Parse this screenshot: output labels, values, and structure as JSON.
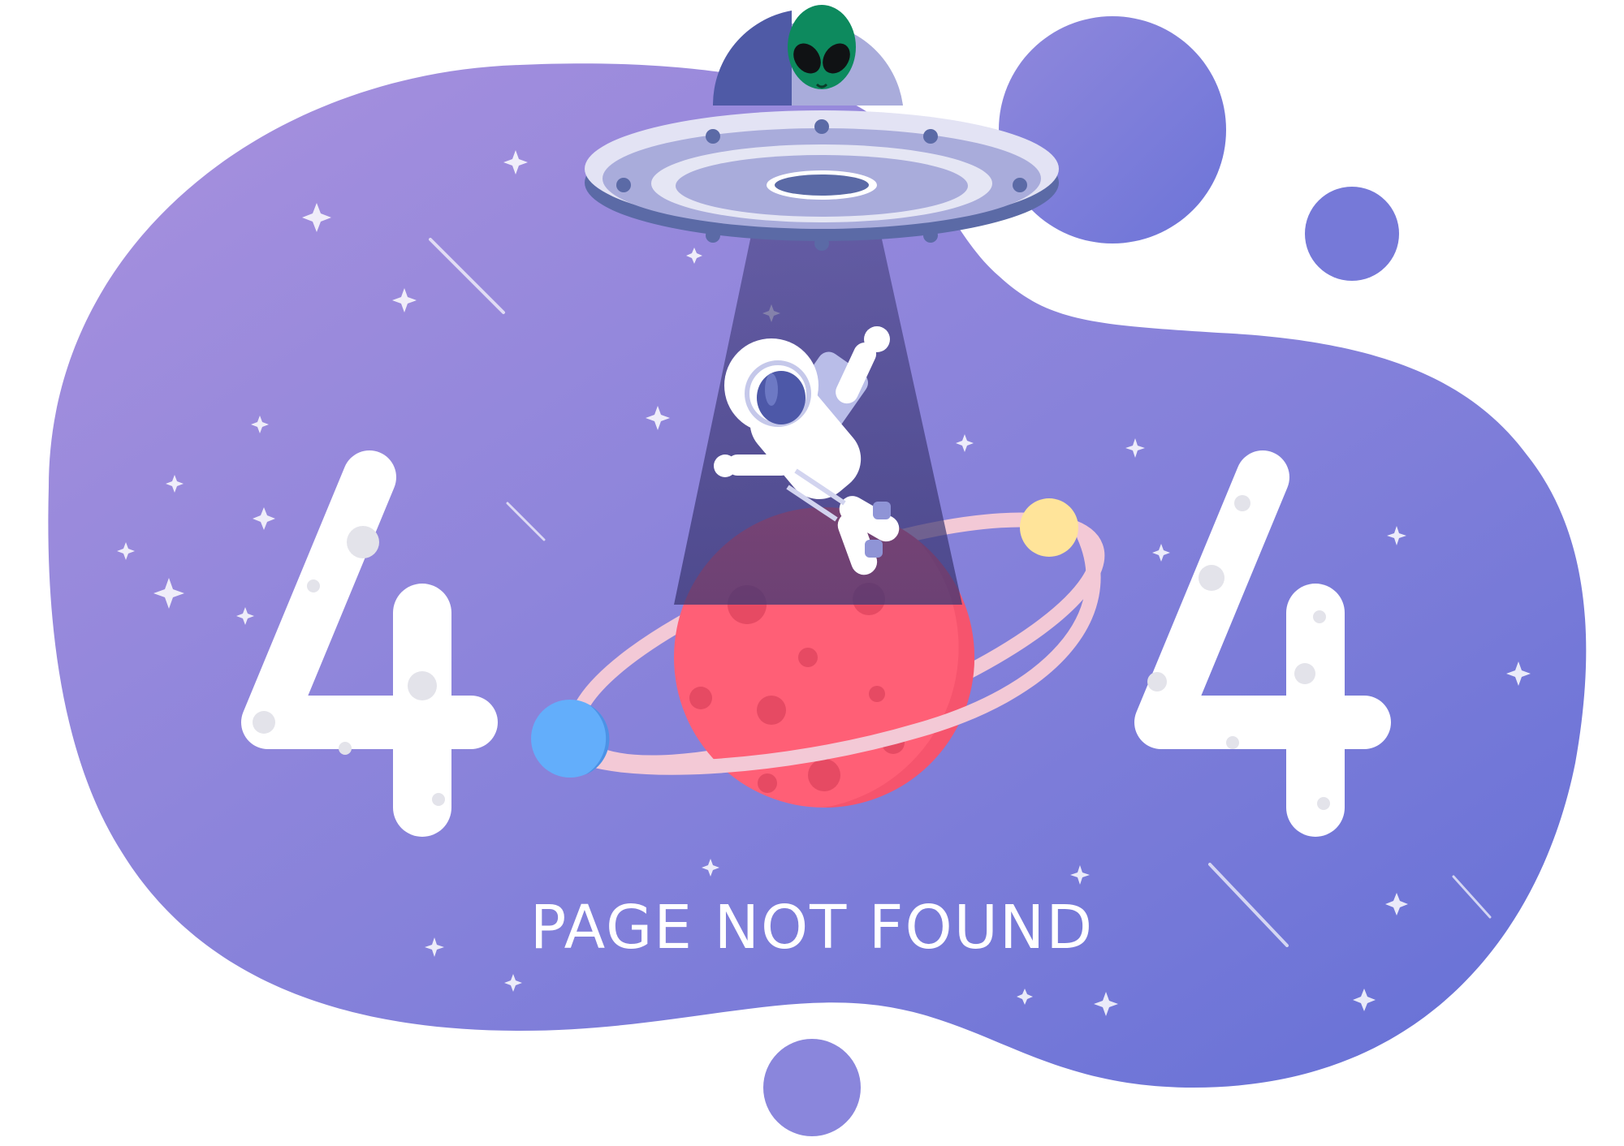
{
  "caption": "PAGE NOT FOUND",
  "digits": {
    "left": "4",
    "right": "4"
  },
  "colors": {
    "background": "#ffffff",
    "blob_start": "#a68fdc",
    "blob_end": "#6a72d8",
    "planet": "#ff5f76",
    "ring": "#f3c9d6",
    "blue_moon": "#63aefb",
    "yellow_moon": "#ffe49a",
    "alien": "#0d8a5e",
    "ufo": "#a9acdb",
    "ufo_dark": "#5b6aa6",
    "beam": "#3d3a7a"
  }
}
